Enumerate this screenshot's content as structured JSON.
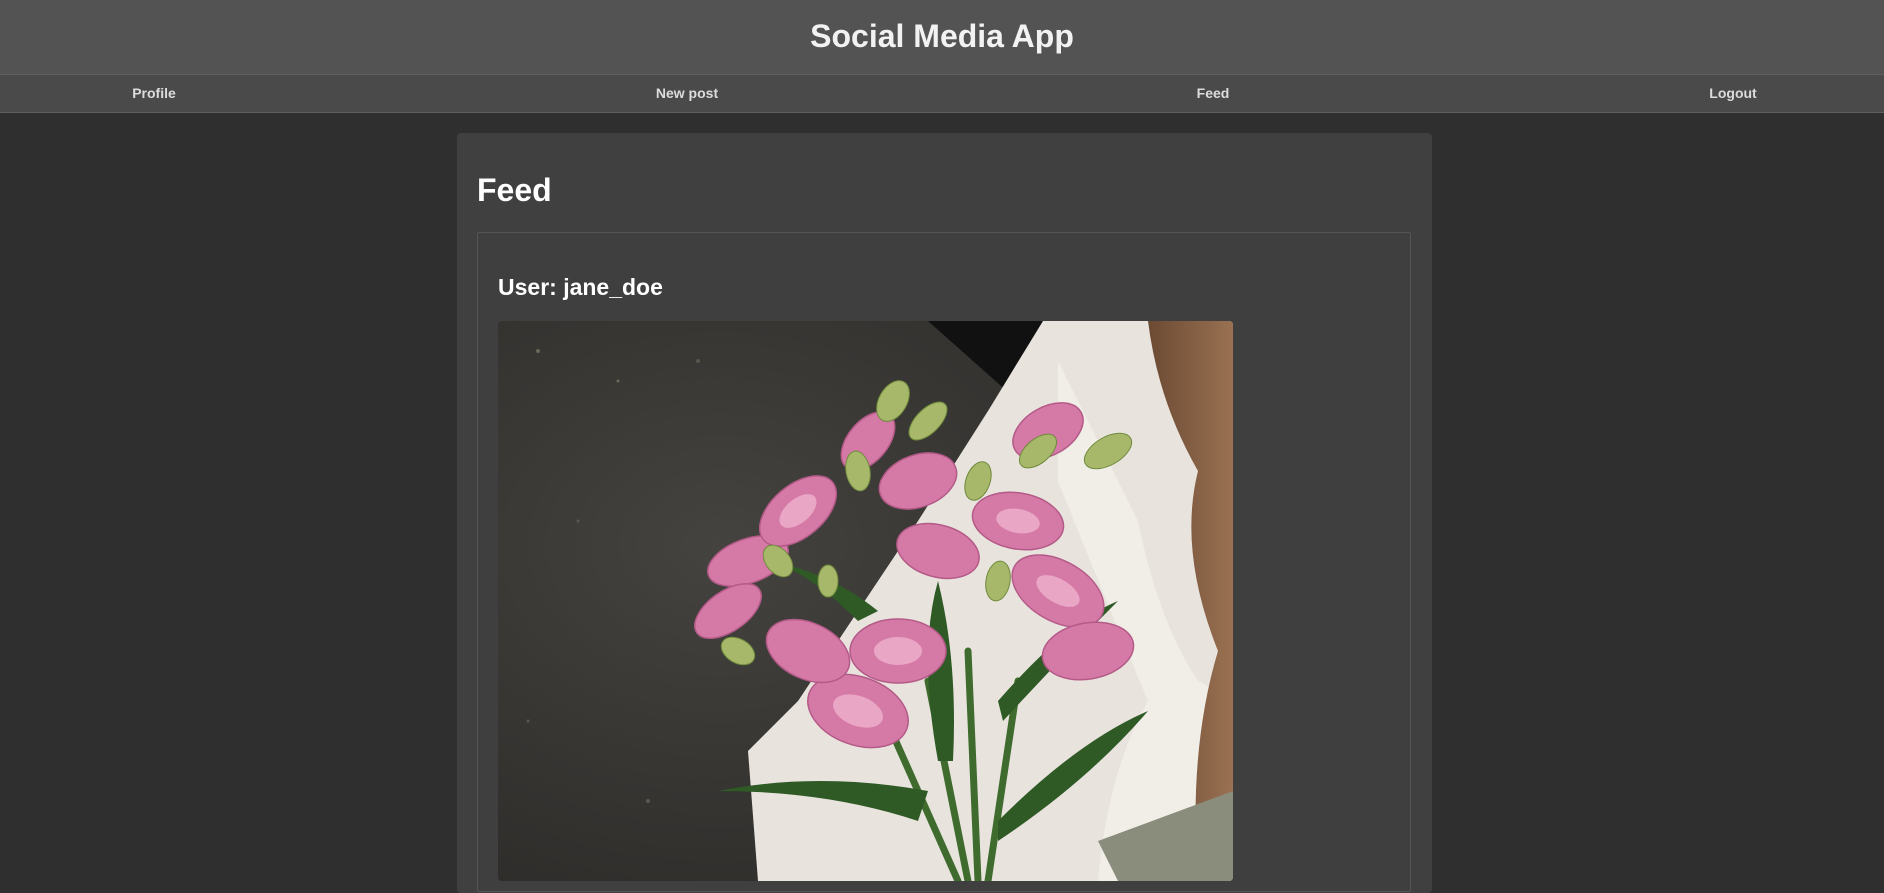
{
  "app": {
    "title": "Social Media App"
  },
  "nav": {
    "items": [
      {
        "label": "Profile"
      },
      {
        "label": "New post"
      },
      {
        "label": "Feed"
      },
      {
        "label": "Logout"
      }
    ]
  },
  "feed": {
    "title": "Feed",
    "posts": [
      {
        "user_label": "User: jane_doe"
      }
    ]
  },
  "colors": {
    "header_bg": "#535353",
    "nav_bg": "#4a4a4a",
    "page_bg": "#2f2f2f",
    "card_bg": "#404040"
  }
}
